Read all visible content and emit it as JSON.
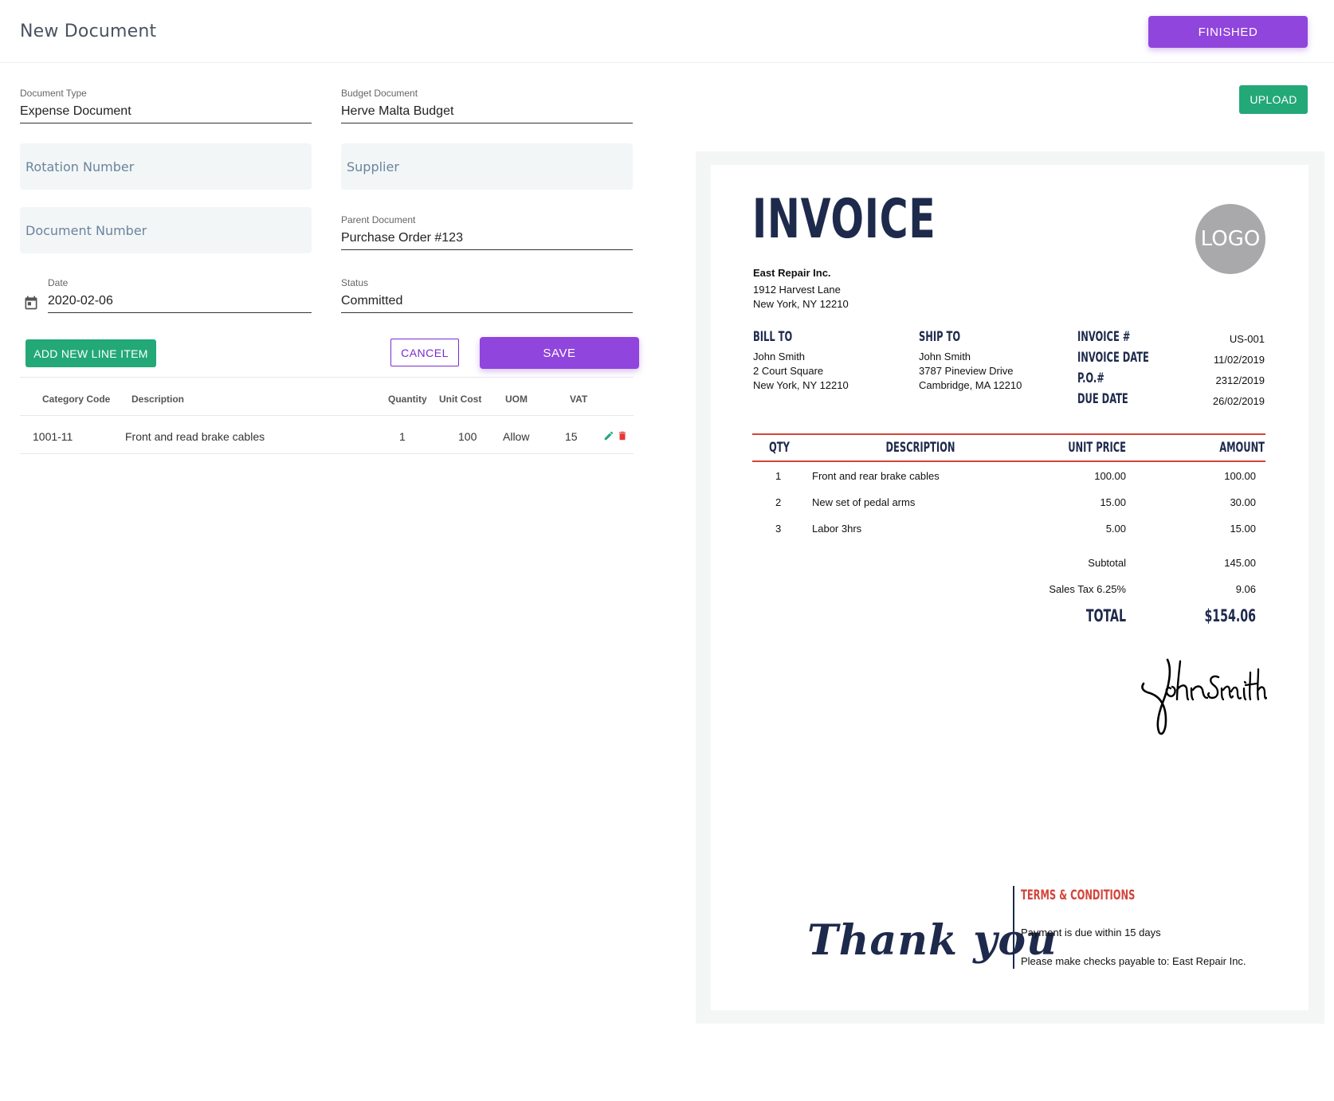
{
  "header": {
    "title": "New Document",
    "finished_label": "FINISHED"
  },
  "form": {
    "document_type": {
      "label": "Document Type",
      "value": "Expense Document"
    },
    "budget_document": {
      "label": "Budget Document",
      "value": "Herve Malta Budget"
    },
    "rotation_number": {
      "placeholder": "Rotation Number"
    },
    "supplier": {
      "placeholder": "Supplier"
    },
    "document_number": {
      "placeholder": "Document Number"
    },
    "parent_document": {
      "label": "Parent Document",
      "value": "Purchase Order #123"
    },
    "date": {
      "label": "Date",
      "value": "2020-02-06"
    },
    "status": {
      "label": "Status",
      "value": "Committed"
    }
  },
  "actions": {
    "add_line_item_label": "ADD NEW LINE ITEM",
    "cancel_label": "CANCEL",
    "save_label": "SAVE",
    "upload_label": "UPLOAD"
  },
  "line_items": {
    "columns": [
      "Category Code",
      "Description",
      "Quantity",
      "Unit Cost",
      "UOM",
      "VAT"
    ],
    "rows": [
      {
        "category_code": "1001-11",
        "description": "Front and read brake cables",
        "quantity": "1",
        "unit_cost": "100",
        "uom": "Allow",
        "vat": "15"
      }
    ]
  },
  "icons": {
    "calendar": "calendar-icon",
    "edit": "pencil-icon",
    "delete": "trash-icon"
  },
  "colors": {
    "primary_purple": "#9045dc",
    "success_green": "#23a878",
    "invoice_navy": "#1e2a4c",
    "invoice_red": "#d4443a"
  },
  "invoice": {
    "title": "INVOICE",
    "logo_text": "LOGO",
    "company": {
      "name": "East Repair Inc.",
      "address1": "1912 Harvest Lane",
      "address2": "New York, NY 12210"
    },
    "bill_to": {
      "heading": "BILL TO",
      "name": "John Smith",
      "address1": "2 Court Square",
      "address2": "New York, NY 12210"
    },
    "ship_to": {
      "heading": "SHIP TO",
      "name": "John Smith",
      "address1": "3787 Pineview Drive",
      "address2": "Cambridge, MA 12210"
    },
    "meta": [
      {
        "label": "INVOICE #",
        "value": "US-001"
      },
      {
        "label": "INVOICE DATE",
        "value": "11/02/2019"
      },
      {
        "label": "P.O.#",
        "value": "2312/2019"
      },
      {
        "label": "DUE DATE",
        "value": "26/02/2019"
      }
    ],
    "columns": {
      "qty": "QTY",
      "description": "DESCRIPTION",
      "unit_price": "UNIT PRICE",
      "amount": "AMOUNT"
    },
    "items": [
      {
        "qty": "1",
        "description": "Front and rear brake cables",
        "unit_price": "100.00",
        "amount": "100.00"
      },
      {
        "qty": "2",
        "description": "New set of pedal arms",
        "unit_price": "15.00",
        "amount": "30.00"
      },
      {
        "qty": "3",
        "description": "Labor 3hrs",
        "unit_price": "5.00",
        "amount": "15.00"
      }
    ],
    "subtotal": {
      "label": "Subtotal",
      "value": "145.00"
    },
    "tax": {
      "label": "Sales Tax 6.25%",
      "value": "9.06"
    },
    "total": {
      "label": "TOTAL",
      "value": "$154.06"
    },
    "signature": "John Smith",
    "thank_you": "Thank you",
    "terms": {
      "heading": "TERMS & CONDITIONS",
      "line1": "Payment is due within 15 days",
      "line2": "Please make checks payable to: East Repair Inc."
    }
  }
}
